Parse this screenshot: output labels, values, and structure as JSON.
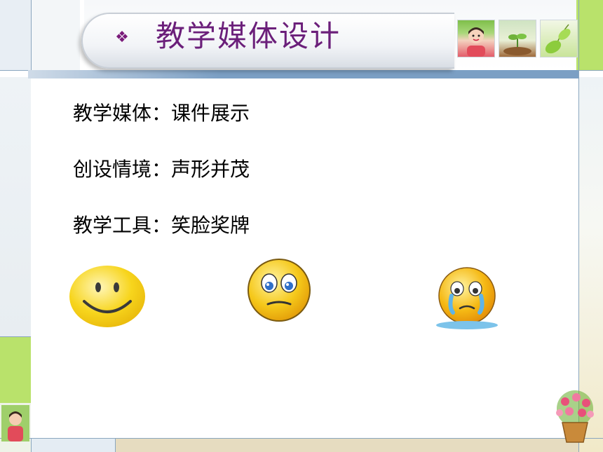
{
  "slide": {
    "title": "教学媒体设计",
    "bullet_symbol": "❖",
    "lines": [
      {
        "label": "教学媒体：课件展示"
      },
      {
        "label": "创设情境：声形并茂"
      },
      {
        "label": "教学工具：笑脸奖牌"
      }
    ],
    "faces": [
      {
        "icon": "smiling-face-icon"
      },
      {
        "icon": "worried-face-icon"
      },
      {
        "icon": "crying-face-icon"
      }
    ]
  },
  "colors": {
    "title": "#6b1f7a",
    "accent_green": "#b9e26b",
    "band_blue": "#7b9fc4",
    "face_yellow": "#f7d51d"
  }
}
